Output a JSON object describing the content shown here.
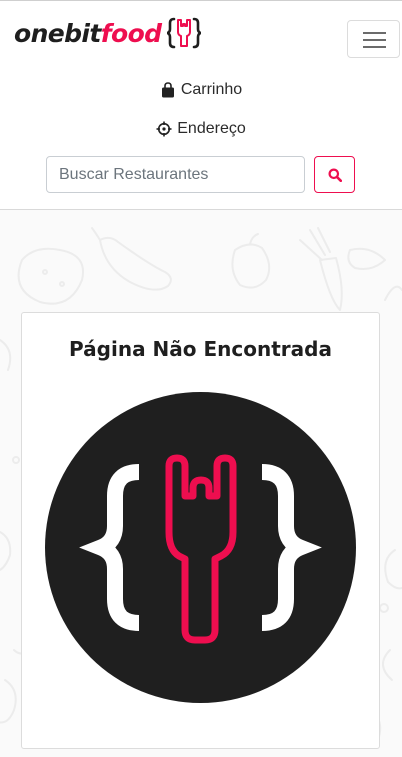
{
  "brand": {
    "name_part1": "onebit",
    "name_part2": "food",
    "icon": "rock-fork-braces-icon",
    "accent_color": "#ee0e4f"
  },
  "nav": {
    "toggler_icon": "hamburger-menu-icon",
    "cart_label": "Carrinho",
    "cart_icon": "shopping-bag-icon",
    "address_label": "Endereço",
    "address_icon": "crosshair-icon"
  },
  "search": {
    "placeholder": "Buscar Restaurantes",
    "value": "",
    "button_icon": "search-icon"
  },
  "card": {
    "title": "Página Não Encontrada",
    "image": "onebitfood-logo-circle"
  }
}
